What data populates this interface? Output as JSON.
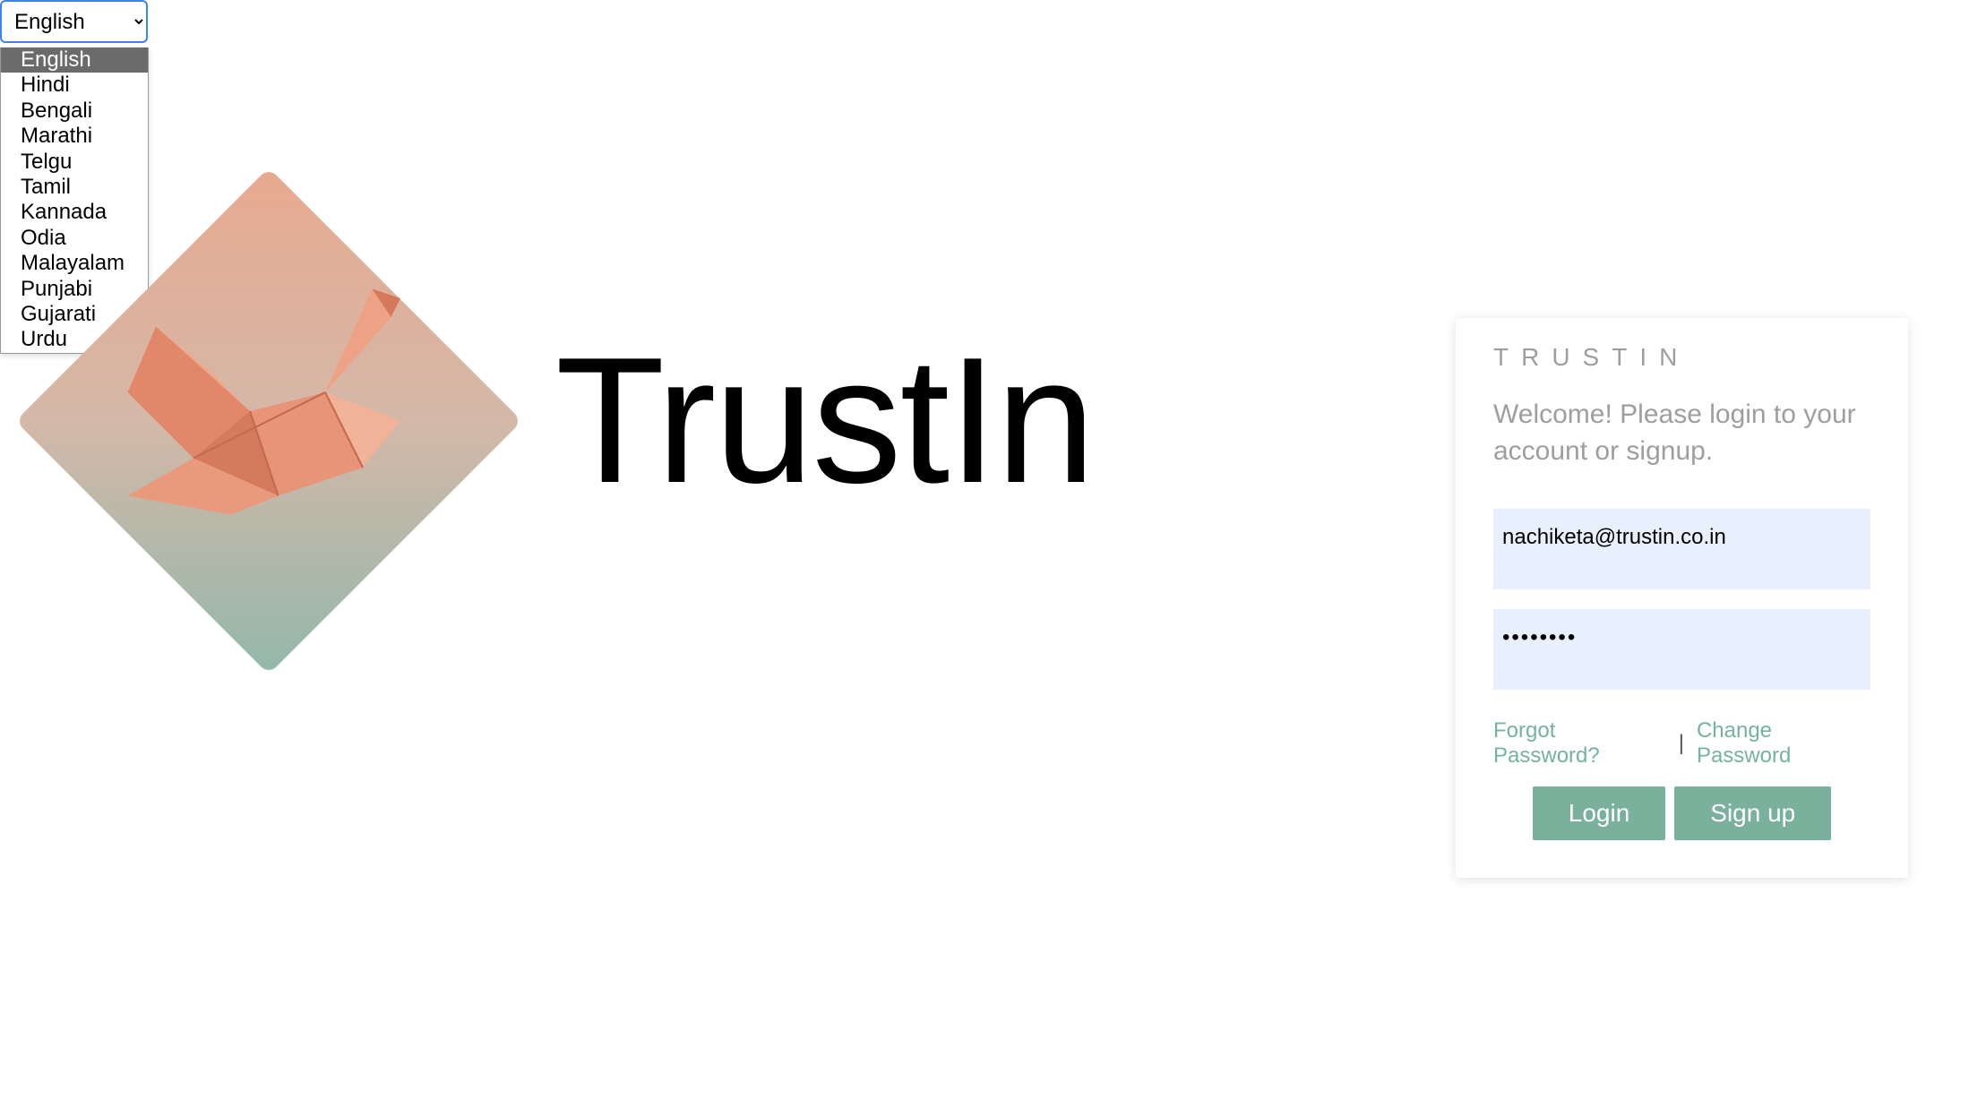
{
  "language_selector": {
    "selected": "English",
    "options": [
      "English",
      "Hindi",
      "Bengali",
      "Marathi",
      "Telgu",
      "Tamil",
      "Kannada",
      "Odia",
      "Malayalam",
      "Punjabi",
      "Gujarati",
      "Urdu"
    ]
  },
  "brand": {
    "name": "TrustIn"
  },
  "login_card": {
    "title": "TRUSTIN",
    "subtitle": "Welcome! Please login to your account or signup.",
    "email_value": "nachiketa@trustin.co.in",
    "password_value": "••••••••",
    "forgot_label": "Forgot Password?",
    "divider": "|",
    "change_label": "Change Password",
    "login_button": "Login",
    "signup_button": "Sign up"
  }
}
